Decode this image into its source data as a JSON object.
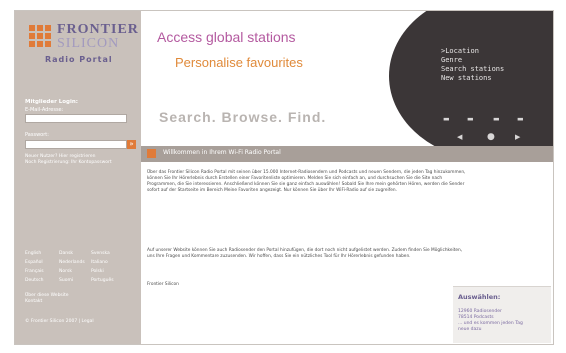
{
  "brand": {
    "logo_line1": "FRONTIER",
    "logo_line2": "SILICON",
    "subtitle": "Radio Portal",
    "accent": "#e07b39",
    "purple": "#6a5f8f"
  },
  "sidebar": {
    "login_heading": "Mitglieder Login:",
    "email_label": "E-Mail-Adresse:",
    "email_value": "",
    "password_label": "Passwort:",
    "password_value": "",
    "go_label": "»",
    "register_link": "Neuer Nutzer? Hier registrieren",
    "forgot_link": "Noch Registrierung: Ihr Kontopasswort",
    "languages": [
      [
        "English",
        "Dansk",
        "Svenska"
      ],
      [
        "Español",
        "Nederlands",
        "Italiano"
      ],
      [
        "Français",
        "Norsk",
        "Polski"
      ],
      [
        "Deutsch",
        "Suomi",
        "Português"
      ]
    ],
    "about_link": "Über diese Website",
    "contact_link": "Kontakt",
    "copyright": "© Frontier Silicon 2007 | Legal"
  },
  "header": {
    "tagline1": "Access global stations",
    "tagline2": "Personalise favourites",
    "tagline3": "Search. Browse. Find.",
    "radio_menu": [
      ">Location",
      "Genre",
      "Search stations",
      "New stations"
    ]
  },
  "content": {
    "title": "Willkommen in Ihrem Wi-Fi Radio Portal",
    "para1": "Über das Frontier Silicon Radio Portal mit seinen über 15.000 Internet-Radiosendern und Podcasts und neuen Sendern, die jeden Tag hinzukommen, können Sie Ihr Hörerlebnis durch Erstellen einer Favoritenliste optimieren. Melden Sie sich einfach an, und durchsuchen Sie die Site nach Programmen, die Sie interessieren. Anschließend können Sie sie ganz einfach auswählen! Sobald Sie Ihre mein gehörten Hören, werden die Sender sofort auf der Startseite im Bereich Meine Favoriten angezeigt. Nur können Sie über Ihr WiFi-Radio auf sie zugreifen.",
    "para2": "Auf unserer Website können Sie auch Radiosender den Portal hinzufügen, die dort noch nicht aufgelistet werden. Zudem finden Sie Möglichkeiten, uns Ihre Fragen und Kommentare zuzusenden. Wir hoffen, dass Sie ein nützliches Tool für Ihr Hörerlebnis gefunden haben.",
    "signoff": "Frontier Silicon"
  },
  "stats_box": {
    "title": "Auswählen:",
    "lines": [
      "12960 Radiosender",
      "78514 Podcasts",
      "... und es kommen jeden Tag",
      "neue dazu"
    ]
  }
}
